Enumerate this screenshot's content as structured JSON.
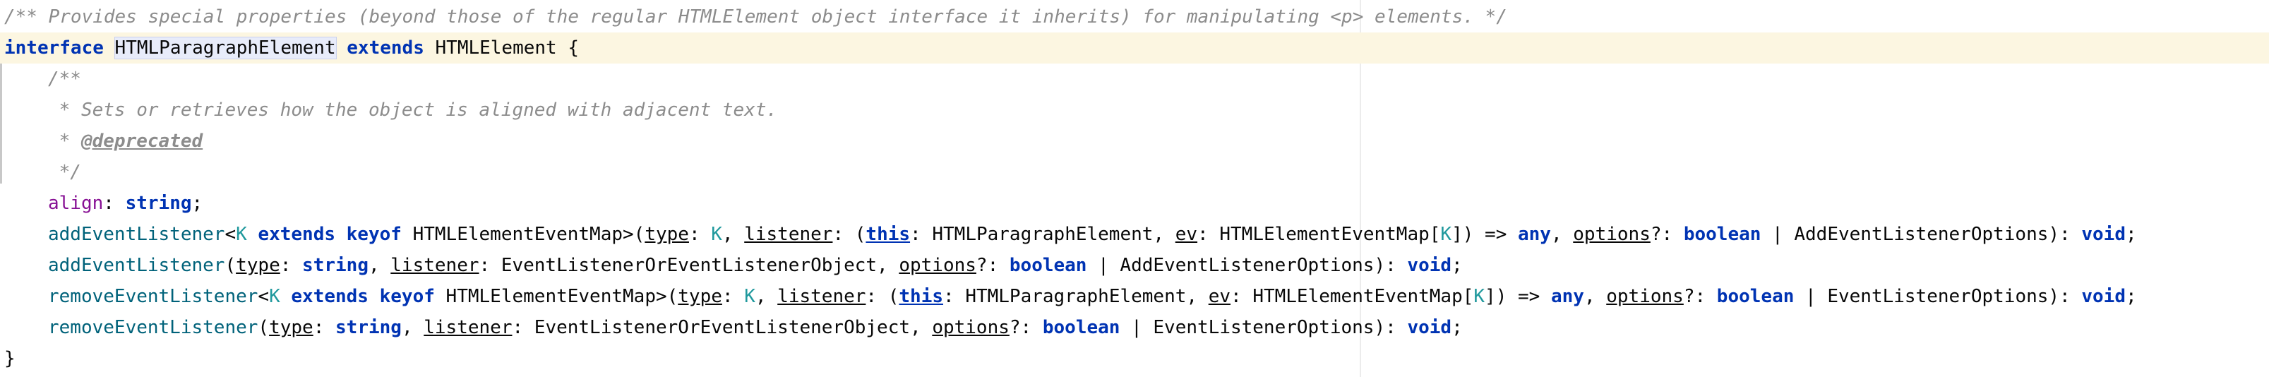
{
  "editor": {
    "lines": [
      {
        "id": "doc",
        "tokens": [
          {
            "t": "/** Provides special properties (beyond those of the regular HTMLElement object interface it inherits) for manipulating <p> elements. */",
            "c": "cm"
          }
        ]
      },
      {
        "id": "decl",
        "current": true,
        "tokens": [
          {
            "t": "interface",
            "c": "kw"
          },
          {
            "t": " "
          },
          {
            "t": "HTMLParagraphElement",
            "c": "ident sel",
            "caret": true
          },
          {
            "t": " "
          },
          {
            "t": "extends",
            "c": "kw"
          },
          {
            "t": " HTMLElement {"
          }
        ]
      },
      {
        "id": "jsdoc-open",
        "indent": 1,
        "tokens": [
          {
            "t": "/**",
            "c": "cm"
          }
        ]
      },
      {
        "id": "jsdoc-desc",
        "indent": 1,
        "tokens": [
          {
            "t": " * Sets or retrieves how the object is aligned with adjacent text.",
            "c": "cm"
          }
        ]
      },
      {
        "id": "jsdoc-tag",
        "indent": 1,
        "tokens": [
          {
            "t": " * ",
            "c": "cm"
          },
          {
            "t": "@deprecated",
            "c": "tag"
          }
        ]
      },
      {
        "id": "jsdoc-close",
        "indent": 1,
        "tokens": [
          {
            "t": " */",
            "c": "cm"
          }
        ]
      },
      {
        "id": "align",
        "indent": 1,
        "tokens": [
          {
            "t": "align",
            "c": "prop"
          },
          {
            "t": ": "
          },
          {
            "t": "string",
            "c": "kw"
          },
          {
            "t": ";"
          }
        ]
      },
      {
        "id": "add1",
        "indent": 1,
        "tokens": [
          {
            "t": "addEventListener",
            "c": "fn"
          },
          {
            "t": "<"
          },
          {
            "t": "K",
            "c": "tp"
          },
          {
            "t": " "
          },
          {
            "t": "extends",
            "c": "kw"
          },
          {
            "t": " "
          },
          {
            "t": "keyof",
            "c": "kw"
          },
          {
            "t": " HTMLElementEventMap>("
          },
          {
            "t": "type",
            "c": "u"
          },
          {
            "t": ": "
          },
          {
            "t": "K",
            "c": "tp"
          },
          {
            "t": ", "
          },
          {
            "t": "listener",
            "c": "u"
          },
          {
            "t": ": ("
          },
          {
            "t": "this",
            "c": "kw u"
          },
          {
            "t": ": HTMLParagraphElement, "
          },
          {
            "t": "ev",
            "c": "u"
          },
          {
            "t": ": HTMLElementEventMap["
          },
          {
            "t": "K",
            "c": "tp"
          },
          {
            "t": "]) => "
          },
          {
            "t": "any",
            "c": "kw"
          },
          {
            "t": ", "
          },
          {
            "t": "options",
            "c": "u"
          },
          {
            "t": "?: "
          },
          {
            "t": "boolean",
            "c": "kw"
          },
          {
            "t": " | AddEventListenerOptions): "
          },
          {
            "t": "void",
            "c": "kw"
          },
          {
            "t": ";"
          }
        ]
      },
      {
        "id": "add2",
        "indent": 1,
        "tokens": [
          {
            "t": "addEventListener",
            "c": "fn"
          },
          {
            "t": "("
          },
          {
            "t": "type",
            "c": "u"
          },
          {
            "t": ": "
          },
          {
            "t": "string",
            "c": "kw"
          },
          {
            "t": ", "
          },
          {
            "t": "listener",
            "c": "u"
          },
          {
            "t": ": EventListenerOrEventListenerObject, "
          },
          {
            "t": "options",
            "c": "u"
          },
          {
            "t": "?: "
          },
          {
            "t": "boolean",
            "c": "kw"
          },
          {
            "t": " | AddEventListenerOptions): "
          },
          {
            "t": "void",
            "c": "kw"
          },
          {
            "t": ";"
          }
        ]
      },
      {
        "id": "remove1",
        "indent": 1,
        "tokens": [
          {
            "t": "removeEventListener",
            "c": "fn"
          },
          {
            "t": "<"
          },
          {
            "t": "K",
            "c": "tp"
          },
          {
            "t": " "
          },
          {
            "t": "extends",
            "c": "kw"
          },
          {
            "t": " "
          },
          {
            "t": "keyof",
            "c": "kw"
          },
          {
            "t": " HTMLElementEventMap>("
          },
          {
            "t": "type",
            "c": "u"
          },
          {
            "t": ": "
          },
          {
            "t": "K",
            "c": "tp"
          },
          {
            "t": ", "
          },
          {
            "t": "listener",
            "c": "u"
          },
          {
            "t": ": ("
          },
          {
            "t": "this",
            "c": "kw u"
          },
          {
            "t": ": HTMLParagraphElement, "
          },
          {
            "t": "ev",
            "c": "u"
          },
          {
            "t": ": HTMLElementEventMap["
          },
          {
            "t": "K",
            "c": "tp"
          },
          {
            "t": "]) => "
          },
          {
            "t": "any",
            "c": "kw"
          },
          {
            "t": ", "
          },
          {
            "t": "options",
            "c": "u"
          },
          {
            "t": "?: "
          },
          {
            "t": "boolean",
            "c": "kw"
          },
          {
            "t": " | EventListenerOptions): "
          },
          {
            "t": "void",
            "c": "kw"
          },
          {
            "t": ";"
          }
        ]
      },
      {
        "id": "remove2",
        "indent": 1,
        "tokens": [
          {
            "t": "removeEventListener",
            "c": "fn"
          },
          {
            "t": "("
          },
          {
            "t": "type",
            "c": "u"
          },
          {
            "t": ": "
          },
          {
            "t": "string",
            "c": "kw"
          },
          {
            "t": ", "
          },
          {
            "t": "listener",
            "c": "u"
          },
          {
            "t": ": EventListenerOrEventListenerObject, "
          },
          {
            "t": "options",
            "c": "u"
          },
          {
            "t": "?: "
          },
          {
            "t": "boolean",
            "c": "kw"
          },
          {
            "t": " | EventListenerOptions): "
          },
          {
            "t": "void",
            "c": "kw"
          },
          {
            "t": ";"
          }
        ]
      },
      {
        "id": "close",
        "tokens": [
          {
            "t": "}"
          }
        ]
      }
    ]
  },
  "colors": {
    "keyword": "#0033b3",
    "comment": "#8c8c8c",
    "property": "#871094",
    "method": "#00627a",
    "type_param": "#20999d",
    "current_line": "#fcf6e1",
    "identifier_highlight": "#e8ecfa"
  }
}
